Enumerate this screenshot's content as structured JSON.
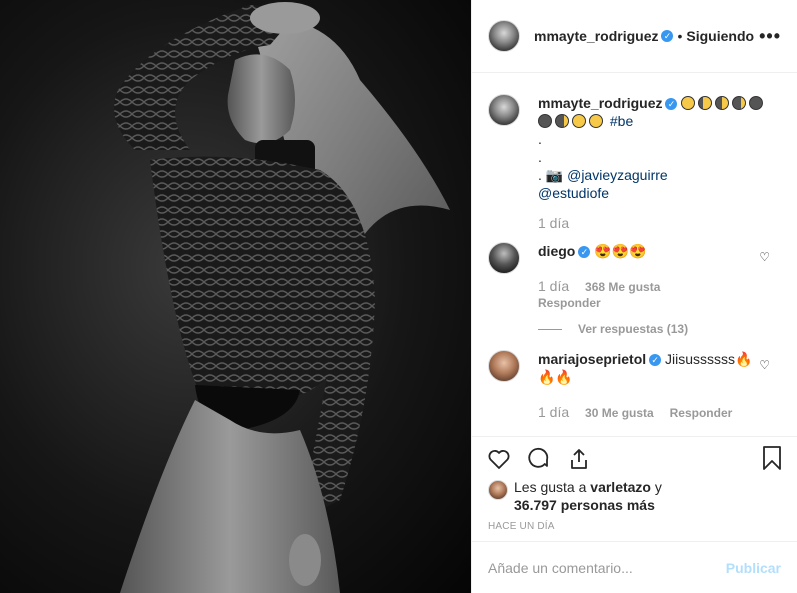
{
  "header": {
    "username": "mmayte_rodriguez",
    "separator": "•",
    "follow_status": "Siguiendo",
    "more_icon": "more-horizontal-icon"
  },
  "caption": {
    "username": "mmayte_rodriguez",
    "emoji_line1": [
      "full-moon",
      "waxing-gibbous-moon",
      "first-quarter-moon",
      "waxing-crescent-moon",
      "new-moon"
    ],
    "emoji_line2": [
      "new-moon",
      "waning-crescent-moon",
      "full-moon",
      "full-moon"
    ],
    "hashtag": "#be",
    "dot1": ".",
    "dot2": ".",
    "camera_prefix": ".",
    "mention1": "@javieyzaguirre",
    "mention2": "@estudiofe",
    "time": "1 día"
  },
  "comments": [
    {
      "username": "diego",
      "text_emojis": "heart-eyes-face x3",
      "time": "1 día",
      "likes": "368 Me gusta",
      "reply": "Responder",
      "view_replies": "Ver respuestas (13)"
    },
    {
      "username": "mariajoseprietol",
      "text": "Jiisussssss",
      "time": "1 día",
      "likes": "30 Me gusta",
      "reply": "Responder"
    }
  ],
  "likes": {
    "prefix": "Les gusta a ",
    "user": "varletazo",
    "suffix": " y",
    "count_text": "36.797 personas más"
  },
  "posted_ago": "HACE UN DÍA",
  "comment_box": {
    "placeholder": "Añade un comentario...",
    "publish": "Publicar"
  },
  "colors": {
    "verified": "#3897f0",
    "link": "#003569",
    "publish_disabled": "#b2dffc",
    "muted": "#999999"
  }
}
